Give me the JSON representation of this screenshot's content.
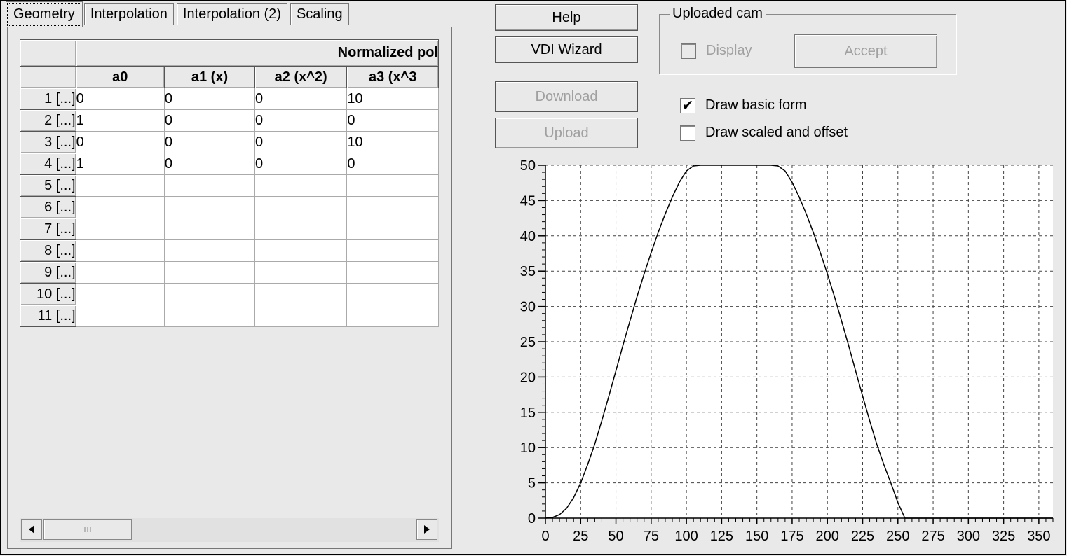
{
  "tabs": [
    {
      "label": "Geometry",
      "active": true
    },
    {
      "label": "Interpolation",
      "active": false
    },
    {
      "label": "Interpolation (2)",
      "active": false
    },
    {
      "label": "Scaling",
      "active": false
    }
  ],
  "grid": {
    "group_header": "Normalized pol",
    "columns": [
      "a0",
      "a1 (x)",
      "a2 (x^2)",
      "a3 (x^3"
    ],
    "rows": [
      {
        "label": "1 [...]",
        "cells": [
          "0",
          "0",
          "0",
          "10"
        ]
      },
      {
        "label": "2 [...]",
        "cells": [
          "1",
          "0",
          "0",
          "0"
        ]
      },
      {
        "label": "3 [...]",
        "cells": [
          "0",
          "0",
          "0",
          "10"
        ]
      },
      {
        "label": "4 [...]",
        "cells": [
          "1",
          "0",
          "0",
          "0"
        ]
      },
      {
        "label": "5 [...]",
        "cells": [
          "",
          "",
          "",
          ""
        ]
      },
      {
        "label": "6 [...]",
        "cells": [
          "",
          "",
          "",
          ""
        ]
      },
      {
        "label": "7 [...]",
        "cells": [
          "",
          "",
          "",
          ""
        ]
      },
      {
        "label": "8 [...]",
        "cells": [
          "",
          "",
          "",
          ""
        ]
      },
      {
        "label": "9 [...]",
        "cells": [
          "",
          "",
          "",
          ""
        ]
      },
      {
        "label": "10 [...]",
        "cells": [
          "",
          "",
          "",
          ""
        ]
      },
      {
        "label": "11 [...]",
        "cells": [
          "",
          "",
          "",
          ""
        ]
      }
    ]
  },
  "buttons": {
    "help": "Help",
    "vdi_wizard": "VDI Wizard",
    "download": "Download",
    "upload": "Upload"
  },
  "uploaded_cam": {
    "title": "Uploaded cam",
    "display_label": "Display",
    "display_checked": false,
    "accept_label": "Accept"
  },
  "options": {
    "draw_basic_form_label": "Draw basic form",
    "draw_basic_form_checked": true,
    "draw_scaled_label": "Draw scaled and offset",
    "draw_scaled_checked": false
  },
  "chart_data": {
    "type": "line",
    "x_ticks": [
      0,
      25,
      50,
      75,
      100,
      125,
      150,
      175,
      200,
      225,
      250,
      275,
      300,
      325,
      350
    ],
    "y_ticks": [
      0,
      5,
      10,
      15,
      20,
      25,
      30,
      35,
      40,
      45,
      50
    ],
    "xlim": [
      0,
      360
    ],
    "ylim": [
      0,
      50
    ],
    "grid": true,
    "series": [
      {
        "x": [
          0,
          5,
          10,
          15,
          20,
          25,
          30,
          35,
          40,
          45,
          50,
          55,
          60,
          65,
          70,
          75,
          80,
          85,
          90,
          95,
          100,
          105,
          110,
          160,
          165,
          170,
          175,
          180,
          185,
          190,
          195,
          200,
          205,
          210,
          215,
          220,
          225,
          230,
          235,
          240,
          245,
          250,
          255,
          360
        ],
        "y": [
          0,
          0.1,
          0.5,
          1.4,
          2.9,
          5.0,
          7.6,
          10.5,
          13.8,
          17.3,
          20.9,
          24.5,
          28.0,
          31.4,
          34.6,
          37.6,
          40.5,
          43.1,
          45.5,
          47.6,
          49.2,
          49.9,
          50,
          50,
          49.9,
          49.2,
          47.6,
          45.5,
          43.1,
          40.5,
          37.6,
          34.6,
          31.4,
          28.0,
          24.5,
          20.9,
          17.3,
          13.8,
          10.5,
          7.6,
          5.0,
          2.2,
          0,
          0
        ]
      }
    ]
  }
}
